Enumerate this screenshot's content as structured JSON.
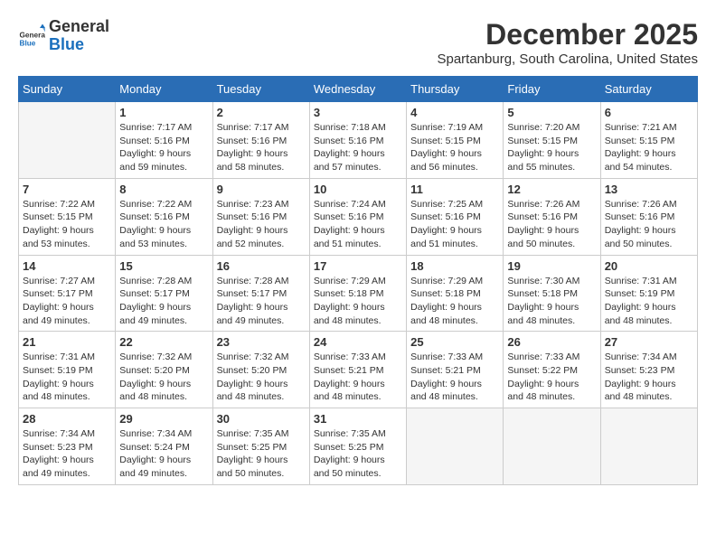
{
  "header": {
    "logo": {
      "general": "General",
      "blue": "Blue"
    },
    "title": "December 2025",
    "location": "Spartanburg, South Carolina, United States"
  },
  "weekdays": [
    "Sunday",
    "Monday",
    "Tuesday",
    "Wednesday",
    "Thursday",
    "Friday",
    "Saturday"
  ],
  "weeks": [
    [
      {
        "day": "",
        "empty": true
      },
      {
        "day": "1",
        "sunrise": "Sunrise: 7:17 AM",
        "sunset": "Sunset: 5:16 PM",
        "daylight": "Daylight: 9 hours and 59 minutes."
      },
      {
        "day": "2",
        "sunrise": "Sunrise: 7:17 AM",
        "sunset": "Sunset: 5:16 PM",
        "daylight": "Daylight: 9 hours and 58 minutes."
      },
      {
        "day": "3",
        "sunrise": "Sunrise: 7:18 AM",
        "sunset": "Sunset: 5:16 PM",
        "daylight": "Daylight: 9 hours and 57 minutes."
      },
      {
        "day": "4",
        "sunrise": "Sunrise: 7:19 AM",
        "sunset": "Sunset: 5:15 PM",
        "daylight": "Daylight: 9 hours and 56 minutes."
      },
      {
        "day": "5",
        "sunrise": "Sunrise: 7:20 AM",
        "sunset": "Sunset: 5:15 PM",
        "daylight": "Daylight: 9 hours and 55 minutes."
      },
      {
        "day": "6",
        "sunrise": "Sunrise: 7:21 AM",
        "sunset": "Sunset: 5:15 PM",
        "daylight": "Daylight: 9 hours and 54 minutes."
      }
    ],
    [
      {
        "day": "7",
        "sunrise": "Sunrise: 7:22 AM",
        "sunset": "Sunset: 5:15 PM",
        "daylight": "Daylight: 9 hours and 53 minutes."
      },
      {
        "day": "8",
        "sunrise": "Sunrise: 7:22 AM",
        "sunset": "Sunset: 5:16 PM",
        "daylight": "Daylight: 9 hours and 53 minutes."
      },
      {
        "day": "9",
        "sunrise": "Sunrise: 7:23 AM",
        "sunset": "Sunset: 5:16 PM",
        "daylight": "Daylight: 9 hours and 52 minutes."
      },
      {
        "day": "10",
        "sunrise": "Sunrise: 7:24 AM",
        "sunset": "Sunset: 5:16 PM",
        "daylight": "Daylight: 9 hours and 51 minutes."
      },
      {
        "day": "11",
        "sunrise": "Sunrise: 7:25 AM",
        "sunset": "Sunset: 5:16 PM",
        "daylight": "Daylight: 9 hours and 51 minutes."
      },
      {
        "day": "12",
        "sunrise": "Sunrise: 7:26 AM",
        "sunset": "Sunset: 5:16 PM",
        "daylight": "Daylight: 9 hours and 50 minutes."
      },
      {
        "day": "13",
        "sunrise": "Sunrise: 7:26 AM",
        "sunset": "Sunset: 5:16 PM",
        "daylight": "Daylight: 9 hours and 50 minutes."
      }
    ],
    [
      {
        "day": "14",
        "sunrise": "Sunrise: 7:27 AM",
        "sunset": "Sunset: 5:17 PM",
        "daylight": "Daylight: 9 hours and 49 minutes."
      },
      {
        "day": "15",
        "sunrise": "Sunrise: 7:28 AM",
        "sunset": "Sunset: 5:17 PM",
        "daylight": "Daylight: 9 hours and 49 minutes."
      },
      {
        "day": "16",
        "sunrise": "Sunrise: 7:28 AM",
        "sunset": "Sunset: 5:17 PM",
        "daylight": "Daylight: 9 hours and 49 minutes."
      },
      {
        "day": "17",
        "sunrise": "Sunrise: 7:29 AM",
        "sunset": "Sunset: 5:18 PM",
        "daylight": "Daylight: 9 hours and 48 minutes."
      },
      {
        "day": "18",
        "sunrise": "Sunrise: 7:29 AM",
        "sunset": "Sunset: 5:18 PM",
        "daylight": "Daylight: 9 hours and 48 minutes."
      },
      {
        "day": "19",
        "sunrise": "Sunrise: 7:30 AM",
        "sunset": "Sunset: 5:18 PM",
        "daylight": "Daylight: 9 hours and 48 minutes."
      },
      {
        "day": "20",
        "sunrise": "Sunrise: 7:31 AM",
        "sunset": "Sunset: 5:19 PM",
        "daylight": "Daylight: 9 hours and 48 minutes."
      }
    ],
    [
      {
        "day": "21",
        "sunrise": "Sunrise: 7:31 AM",
        "sunset": "Sunset: 5:19 PM",
        "daylight": "Daylight: 9 hours and 48 minutes."
      },
      {
        "day": "22",
        "sunrise": "Sunrise: 7:32 AM",
        "sunset": "Sunset: 5:20 PM",
        "daylight": "Daylight: 9 hours and 48 minutes."
      },
      {
        "day": "23",
        "sunrise": "Sunrise: 7:32 AM",
        "sunset": "Sunset: 5:20 PM",
        "daylight": "Daylight: 9 hours and 48 minutes."
      },
      {
        "day": "24",
        "sunrise": "Sunrise: 7:33 AM",
        "sunset": "Sunset: 5:21 PM",
        "daylight": "Daylight: 9 hours and 48 minutes."
      },
      {
        "day": "25",
        "sunrise": "Sunrise: 7:33 AM",
        "sunset": "Sunset: 5:21 PM",
        "daylight": "Daylight: 9 hours and 48 minutes."
      },
      {
        "day": "26",
        "sunrise": "Sunrise: 7:33 AM",
        "sunset": "Sunset: 5:22 PM",
        "daylight": "Daylight: 9 hours and 48 minutes."
      },
      {
        "day": "27",
        "sunrise": "Sunrise: 7:34 AM",
        "sunset": "Sunset: 5:23 PM",
        "daylight": "Daylight: 9 hours and 48 minutes."
      }
    ],
    [
      {
        "day": "28",
        "sunrise": "Sunrise: 7:34 AM",
        "sunset": "Sunset: 5:23 PM",
        "daylight": "Daylight: 9 hours and 49 minutes."
      },
      {
        "day": "29",
        "sunrise": "Sunrise: 7:34 AM",
        "sunset": "Sunset: 5:24 PM",
        "daylight": "Daylight: 9 hours and 49 minutes."
      },
      {
        "day": "30",
        "sunrise": "Sunrise: 7:35 AM",
        "sunset": "Sunset: 5:25 PM",
        "daylight": "Daylight: 9 hours and 50 minutes."
      },
      {
        "day": "31",
        "sunrise": "Sunrise: 7:35 AM",
        "sunset": "Sunset: 5:25 PM",
        "daylight": "Daylight: 9 hours and 50 minutes."
      },
      {
        "day": "",
        "empty": true
      },
      {
        "day": "",
        "empty": true
      },
      {
        "day": "",
        "empty": true
      }
    ]
  ]
}
